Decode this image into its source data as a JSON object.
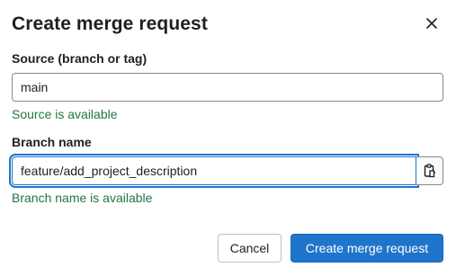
{
  "dialog": {
    "title": "Create merge request",
    "close_icon": "close-icon"
  },
  "source": {
    "label": "Source (branch or tag)",
    "value": "main",
    "help": "Source is available"
  },
  "branch": {
    "label": "Branch name",
    "value": "feature/add_project_description",
    "help": "Branch name is available",
    "copy_icon": "clipboard-icon"
  },
  "footer": {
    "cancel_label": "Cancel",
    "submit_label": "Create merge request"
  },
  "colors": {
    "primary": "#1f75cb",
    "success_text": "#217645",
    "text": "#1f1e24",
    "border": "#89888d"
  }
}
